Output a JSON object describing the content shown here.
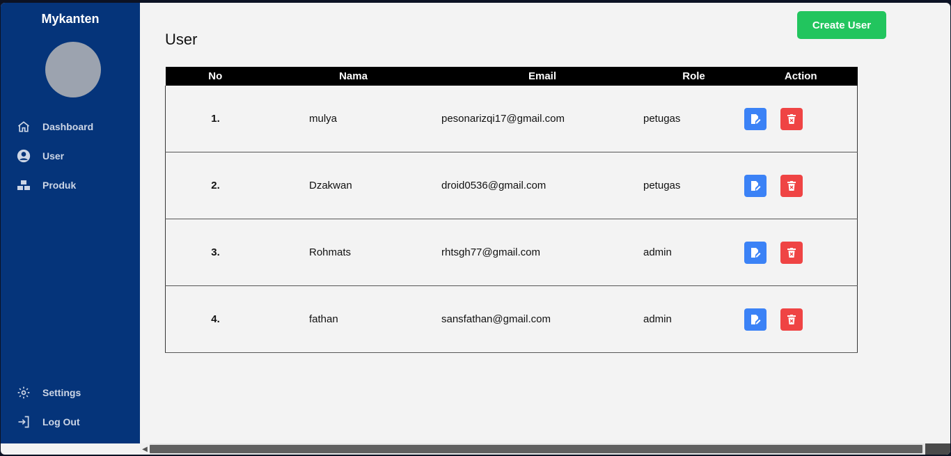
{
  "sidebar": {
    "brand": "Mykanten",
    "nav": [
      {
        "label": "Dashboard",
        "icon": "home-icon"
      },
      {
        "label": "User",
        "icon": "user-circle-icon"
      },
      {
        "label": "Produk",
        "icon": "boxes-icon"
      }
    ],
    "bottom": [
      {
        "label": "Settings",
        "icon": "gear-icon"
      },
      {
        "label": "Log Out",
        "icon": "logout-icon"
      }
    ]
  },
  "main": {
    "title": "User",
    "create_button": "Create User",
    "table": {
      "headers": [
        "No",
        "Nama",
        "Email",
        "Role",
        "Action"
      ],
      "rows": [
        {
          "no": "1.",
          "nama": "mulya",
          "email": "pesonarizqi17@gmail.com",
          "role": "petugas"
        },
        {
          "no": "2.",
          "nama": "Dzakwan",
          "email": "droid0536@gmail.com",
          "role": "petugas"
        },
        {
          "no": "3.",
          "nama": "Rohmats",
          "email": "rhtsgh77@gmail.com",
          "role": "admin"
        },
        {
          "no": "4.",
          "nama": "fathan",
          "email": "sansfathan@gmail.com",
          "role": "admin"
        }
      ]
    }
  },
  "colors": {
    "sidebar": "#05347a",
    "create": "#22c55e",
    "edit": "#3b82f6",
    "delete": "#ef4444"
  }
}
